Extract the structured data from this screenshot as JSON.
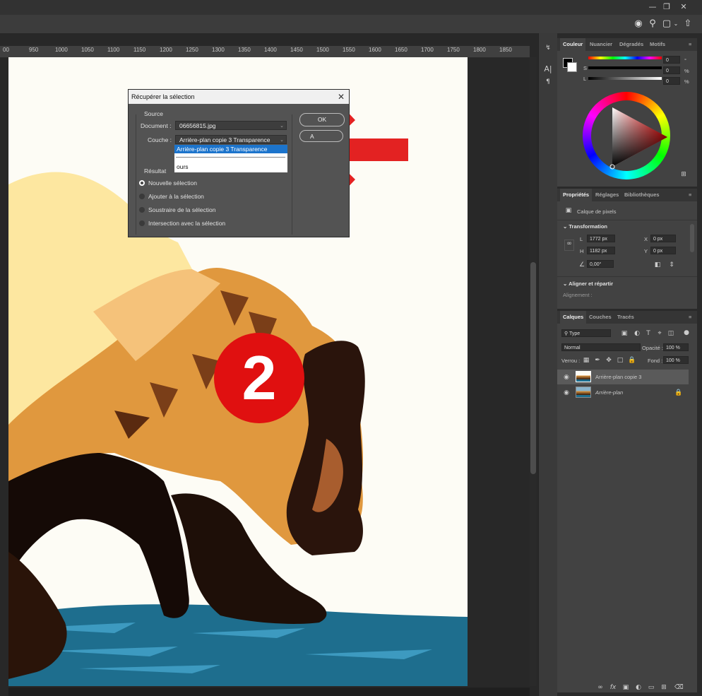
{
  "ruler": {
    "ticks": [
      "00",
      "950",
      "1000",
      "1050",
      "1100",
      "1150",
      "1200",
      "1250",
      "1300",
      "1350",
      "1400",
      "1450",
      "1500",
      "1550",
      "1600",
      "1650",
      "1700",
      "1750",
      "1800",
      "1850"
    ]
  },
  "badge": {
    "number": "2",
    "color": "#e01010"
  },
  "arrow": {
    "color": "#e32222"
  },
  "dialog": {
    "title": "Récupérer la sélection",
    "source_label": "Source",
    "document_label": "Document :",
    "document_value": "06656815.jpg",
    "couche_label": "Couche :",
    "couche_value": "Arrière-plan copie 3 Transparence",
    "ok_label": "OK",
    "cancel_label": "A",
    "dropdown_options": [
      "Arrière-plan copie 3 Transparence",
      "ours"
    ],
    "result_label": "Résultat",
    "result_options": [
      {
        "label": "Nouvelle sélection",
        "selected": true
      },
      {
        "label": "Ajouter à la sélection",
        "selected": false
      },
      {
        "label": "Soustraire de la sélection",
        "selected": false
      },
      {
        "label": "Intersection avec la sélection",
        "selected": false
      }
    ]
  },
  "color_panel": {
    "tabs": [
      "Couleur",
      "Nuancier",
      "Dégradés",
      "Motifs"
    ],
    "sliders": [
      {
        "label": "",
        "value": "0",
        "unit": "°"
      },
      {
        "label": "S",
        "value": "0",
        "unit": "%"
      },
      {
        "label": "L",
        "value": "0",
        "unit": "%"
      }
    ]
  },
  "properties_panel": {
    "tabs": [
      "Propriétés",
      "Réglages",
      "Bibliothèques"
    ],
    "layer_type": "Calque de pixels",
    "transform_label": "Transformation",
    "w_label": "L",
    "w_value": "1772 px",
    "h_label": "H",
    "h_value": "1182 px",
    "x_label": "X",
    "x_value": "0 px",
    "y_label": "Y",
    "y_value": "0 px",
    "angle_value": "0,00°",
    "align_label": "Aligner et répartir",
    "alignment_label": "Alignement :"
  },
  "layers_panel": {
    "tabs": [
      "Calques",
      "Couches",
      "Tracés"
    ],
    "filter_label": "Type",
    "blend_mode": "Normal",
    "opacity_label": "Opacité :",
    "opacity_value": "100 %",
    "lock_label": "Verrou :",
    "fill_label": "Fond :",
    "fill_value": "100 %",
    "layers": [
      {
        "name": "Arrière-plan copie 3",
        "selected": true
      },
      {
        "name": "Arrière-plan",
        "selected": false
      }
    ]
  }
}
